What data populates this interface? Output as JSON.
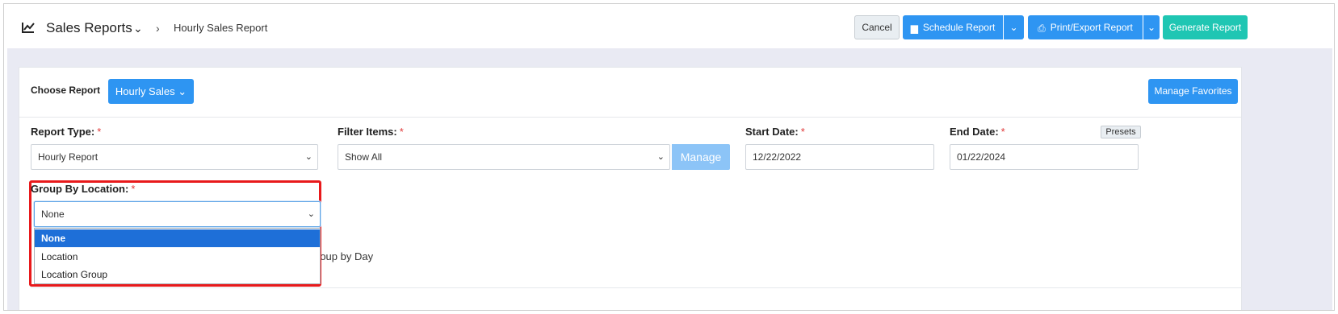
{
  "header": {
    "title": "Sales Reports",
    "breadcrumb": "Hourly Sales Report",
    "buttons": {
      "cancel": "Cancel",
      "schedule": "Schedule Report",
      "print": "Print/Export Report",
      "generate": "Generate Report"
    }
  },
  "choose": {
    "label": "Choose Report",
    "report_button": "Hourly Sales",
    "favorites_button": "Manage Favorites"
  },
  "fields": {
    "report_type": {
      "label": "Report Type:",
      "value": "Hourly Report"
    },
    "filter_items": {
      "label": "Filter Items:",
      "value": "Show All",
      "manage": "Manage"
    },
    "start_date": {
      "label": "Start Date:",
      "value": "12/22/2022"
    },
    "end_date": {
      "label": "End Date:",
      "value": "01/22/2024",
      "presets": "Presets"
    },
    "group_by_location": {
      "label": "Group By Location:",
      "value": "None",
      "options": [
        "None",
        "Location",
        "Location Group"
      ]
    },
    "group_by_day_partial": "roup by Day"
  },
  "colors": {
    "primary": "#2e95f2",
    "generate": "#1fc6b3",
    "highlight_box": "#e8191b",
    "option_selected": "#1e6fd8"
  }
}
